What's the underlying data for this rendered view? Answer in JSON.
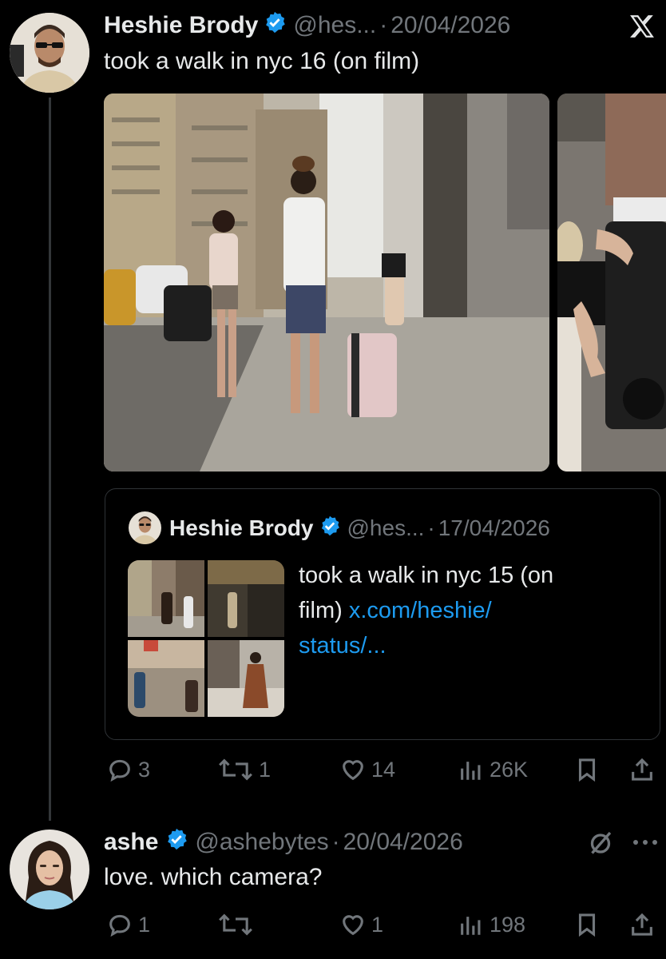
{
  "tweet": {
    "author_name": "Heshie Brody",
    "handle": "@hes...",
    "separator": "·",
    "date": "20/04/2026",
    "text": "took a walk in nyc 16 (on film)",
    "quote": {
      "author_name": "Heshie Brody",
      "handle": "@hes...",
      "separator": "·",
      "date": "17/04/2026",
      "text_line1": "took a walk in nyc 15 (on",
      "text_line2_plain": "film)",
      "text_line2_link": "x.com/heshie/",
      "text_line3_link": "status/..."
    },
    "stats": {
      "replies": "3",
      "reposts": "1",
      "likes": "14",
      "views": "26K"
    }
  },
  "reply": {
    "author_name": "ashe",
    "handle": "@ashebytes",
    "separator": "·",
    "date": "20/04/2026",
    "text": "love. which camera?",
    "stats": {
      "replies": "1",
      "reposts": "",
      "likes": "1",
      "views": "198"
    }
  },
  "icons": {
    "close": "x-logo-icon",
    "verified": "verified-badge-icon",
    "reply": "reply-icon",
    "repost": "repost-icon",
    "like": "heart-icon",
    "views": "views-icon",
    "bookmark": "bookmark-icon",
    "share": "share-icon",
    "mute": "mute-icon",
    "more": "more-icon"
  },
  "colors": {
    "background": "#000000",
    "text": "#e7e9ea",
    "muted": "#71767b",
    "link": "#1d9bf0",
    "verified": "#1d9bf0"
  }
}
